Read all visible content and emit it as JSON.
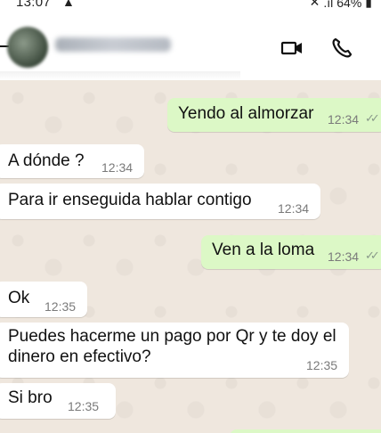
{
  "status_bar": {
    "time": "13:07",
    "battery": "64%"
  },
  "header": {
    "contact_name": "Contact Name"
  },
  "messages": [
    {
      "direction": "out",
      "text": "Yendo al almorzar",
      "time": "12:34",
      "status": "read"
    },
    {
      "direction": "in",
      "text": "A dónde ?",
      "time": "12:34"
    },
    {
      "direction": "in",
      "text": "Para ir enseguida hablar contigo",
      "time": "12:34"
    },
    {
      "direction": "out",
      "text": "Ven a la loma",
      "time": "12:34",
      "status": "read"
    },
    {
      "direction": "in",
      "text": "Ok",
      "time": "12:35"
    },
    {
      "direction": "in",
      "text": "Puedes hacerme un pago por Qr y te doy el dinero en efectivo?",
      "time": "12:35"
    },
    {
      "direction": "in",
      "text": "Si bro",
      "time": "12:35"
    }
  ],
  "colors": {
    "chat_background": "#efe7de",
    "outgoing_bubble": "#dcf8c6",
    "incoming_bubble": "#ffffff"
  }
}
